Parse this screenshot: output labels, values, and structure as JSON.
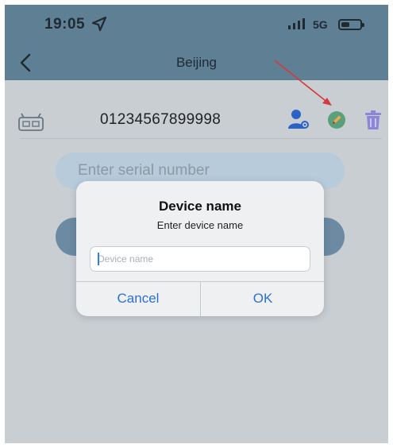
{
  "status_bar": {
    "time": "19:05",
    "network": "5G",
    "battery_level": 0.45
  },
  "nav": {
    "title": "Beijing"
  },
  "device": {
    "id": "01234567899998"
  },
  "form": {
    "serial_placeholder": "Enter serial number"
  },
  "dialog": {
    "title": "Device name",
    "message": "Enter device name",
    "input_value": "",
    "input_placeholder": "Device name",
    "cancel_label": "Cancel",
    "ok_label": "OK"
  },
  "colors": {
    "nav_bar": "#5f7f95",
    "accent_blue": "#2d6fd6",
    "trash_purple": "#8b86d8",
    "edit_green": "#5aa07a",
    "annotation_red": "#d33a3a"
  }
}
